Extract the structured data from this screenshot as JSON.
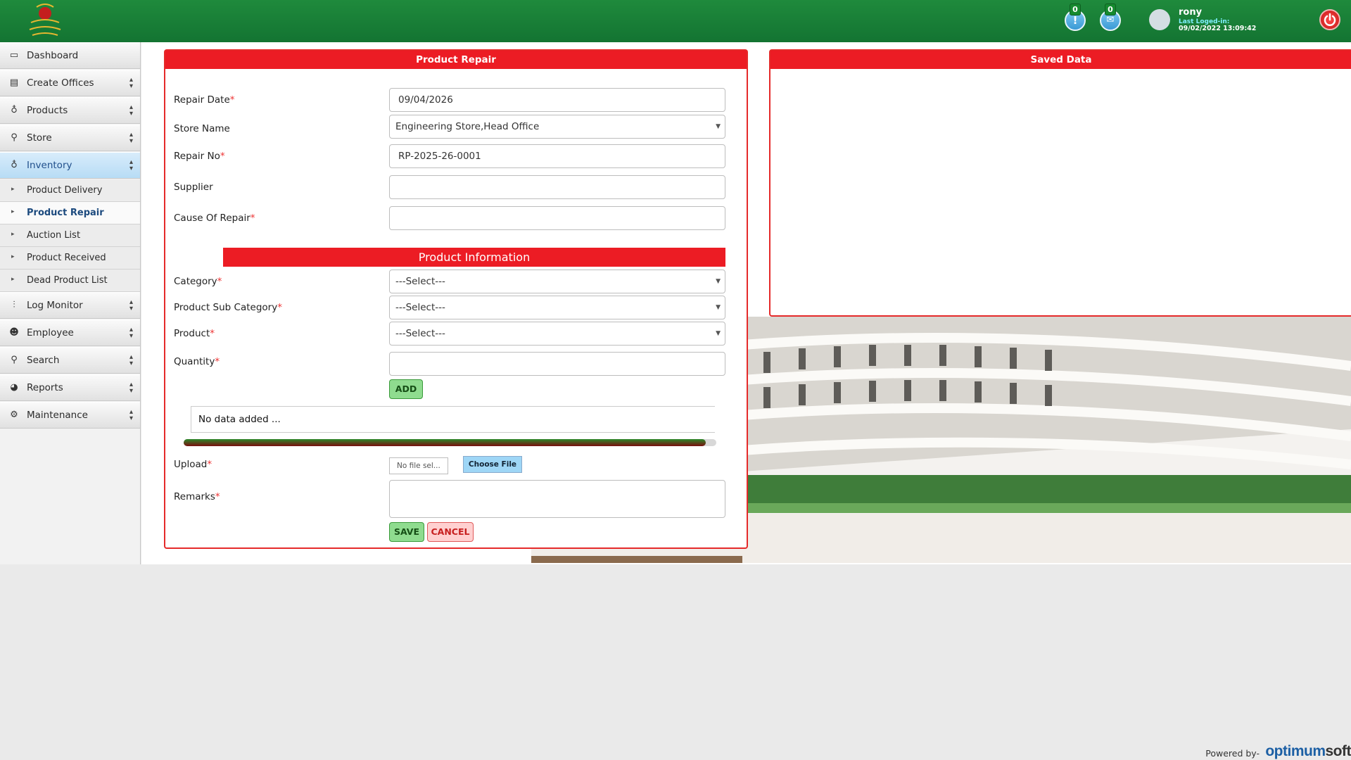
{
  "header": {
    "notifications_count": "0",
    "messages_count": "0",
    "username": "rony",
    "last_logged_label": "Last Loged-in:",
    "last_logged_value": "09/02/2022 13:09:42"
  },
  "sidebar": {
    "items": [
      {
        "label": "Dashboard",
        "icon": "monitor-icon"
      },
      {
        "label": "Create Offices",
        "icon": "building-icon"
      },
      {
        "label": "Products",
        "icon": "lightbulb-icon"
      },
      {
        "label": "Store",
        "icon": "search-icon"
      },
      {
        "label": "Inventory",
        "icon": "lightbulb-icon",
        "active": true
      },
      {
        "label": "Log Monitor",
        "icon": "sliders-icon"
      },
      {
        "label": "Employee",
        "icon": "users-icon"
      },
      {
        "label": "Search",
        "icon": "search-icon"
      },
      {
        "label": "Reports",
        "icon": "pie-chart-icon"
      },
      {
        "label": "Maintenance",
        "icon": "gear-icon"
      }
    ],
    "inventory_subitems": [
      {
        "label": "Product Delivery"
      },
      {
        "label": "Product Repair",
        "active": true
      },
      {
        "label": "Auction List"
      },
      {
        "label": "Product Received"
      },
      {
        "label": "Dead Product List"
      }
    ]
  },
  "form": {
    "title": "Product Repair",
    "repair_date_label": "Repair Date",
    "repair_date_value": "09/04/2026",
    "store_name_label": "Store Name",
    "store_name_value": "Engineering Store,Head Office",
    "repair_no_label": "Repair No",
    "repair_no_value": "RP-2025-26-0001",
    "supplier_label": "Supplier",
    "supplier_value": "",
    "cause_label": "Cause Of Repair",
    "cause_value": "",
    "section_title": "Product Information",
    "category_label": "Category",
    "category_value": "---Select---",
    "subcategory_label": "Product Sub Category",
    "subcategory_value": "---Select---",
    "product_label": "Product",
    "product_value": "---Select---",
    "quantity_label": "Quantity",
    "quantity_value": "",
    "add_label": "ADD",
    "no_data_text": "No data added ...",
    "progress_fraction": 0.98,
    "upload_label": "Upload",
    "file_placeholder": "No file sel...",
    "choose_file_label": "Choose File",
    "remarks_label": "Remarks",
    "save_label": "SAVE",
    "cancel_label": "CANCEL",
    "required_mark": "*"
  },
  "saved": {
    "title": "Saved Data"
  },
  "footer": {
    "powered_by": "Powered by-",
    "brand_a": "optimum",
    "brand_b": "soft"
  },
  "colors": {
    "header_green": "#1f8a3c",
    "panel_red": "#ec1c24",
    "brand_blue": "#1c5fa4"
  }
}
